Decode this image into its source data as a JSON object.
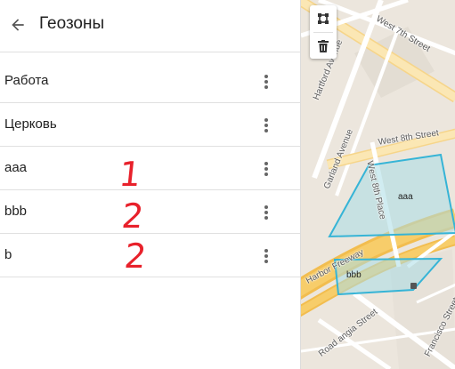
{
  "header": {
    "title": "Геозоны",
    "back_icon": "arrow-left-icon"
  },
  "zones": [
    {
      "name": "Работа",
      "menu_icon": "more-vert-icon"
    },
    {
      "name": "Церковь",
      "menu_icon": "more-vert-icon"
    },
    {
      "name": "aaa",
      "menu_icon": "more-vert-icon",
      "annotation": "1"
    },
    {
      "name": "bbb",
      "menu_icon": "more-vert-icon",
      "annotation": "2"
    },
    {
      "name": "b",
      "menu_icon": "more-vert-icon",
      "annotation": "2"
    }
  ],
  "map": {
    "tools": [
      "draw-polygon-icon",
      "trash-icon"
    ],
    "streets": {
      "west_7th": "West 7th Street",
      "hartford": "Hartford Avenue",
      "west_8th": "West 8th Street",
      "garland": "Garland Avenue",
      "west_8th_place": "West 8th Place",
      "harbor": "Harbor Freeway",
      "francisco": "Francisco Street",
      "road_angia": "Road angia Street"
    },
    "zone_labels": {
      "aaa": "aaa",
      "bbb": "bbb"
    },
    "colors": {
      "geofence_stroke": "#36b4d6",
      "geofence_fill": "rgba(170,220,230,0.55)",
      "freeway": "#f7cd6a",
      "annotation": "#e8212b"
    }
  }
}
